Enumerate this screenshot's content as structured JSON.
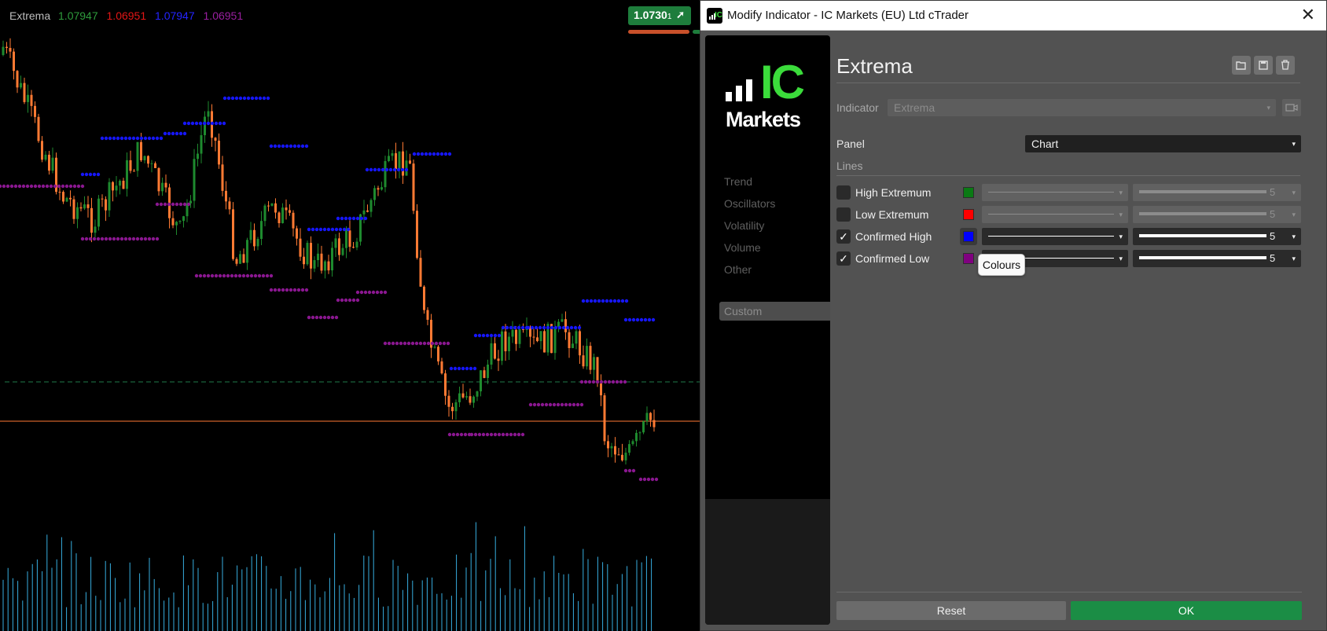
{
  "chart": {
    "legend": {
      "name": "Extrema",
      "values": [
        {
          "text": "1.07947",
          "color": "#2e9b3c"
        },
        {
          "text": "1.06951",
          "color": "#e31616"
        },
        {
          "text": "1.07947",
          "color": "#2424ff"
        },
        {
          "text": "1.06951",
          "color": "#9a1fa0"
        }
      ]
    },
    "price": {
      "main": "1.0730",
      "small": "1",
      "arrow": "➚"
    },
    "colors": {
      "bull": "#1e8a2e",
      "bear": "#ff7a33",
      "confirmed_high": "#1616ff",
      "confirmed_low": "#8a1790",
      "volume": "#37aee0",
      "horizontal_line": "#ff7a33",
      "dashed_line": "#1f7a4a"
    }
  },
  "dialog": {
    "title": "Modify Indicator - IC Markets (EU) Ltd cTrader",
    "close": "✕",
    "logo": {
      "top": "IC",
      "bottom": "Markets"
    },
    "categories": [
      "Trend",
      "Oscillators",
      "Volatility",
      "Volume",
      "Other"
    ],
    "active_category": "Custom",
    "indicator_title": "Extrema",
    "icons": {
      "open": "open-folder-icon",
      "save": "save-icon",
      "delete": "trash-icon"
    },
    "indicator_label": "Indicator",
    "indicator_value": "Extrema",
    "panel_label": "Panel",
    "panel_value": "Chart",
    "lines_header": "Lines",
    "lines": [
      {
        "label": "High Extremum",
        "checked": false,
        "color": "#0a7a14",
        "thickness": "5"
      },
      {
        "label": "Low Extremum",
        "checked": false,
        "color": "#ff0000",
        "thickness": "5"
      },
      {
        "label": "Confirmed High",
        "checked": true,
        "color": "#0000ff",
        "thickness": "5"
      },
      {
        "label": "Confirmed Low",
        "checked": true,
        "color": "#800080",
        "thickness": "5"
      }
    ],
    "tooltip": "Colours",
    "reset_label": "Reset",
    "ok_label": "OK",
    "check_mark": "✓",
    "chevron": "▾"
  }
}
